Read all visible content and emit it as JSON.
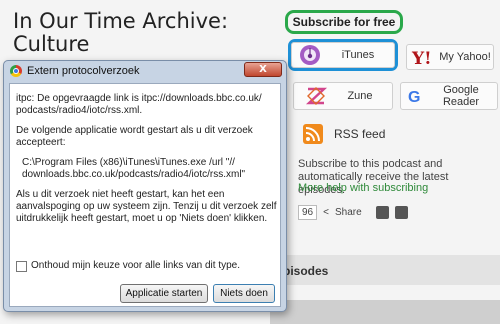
{
  "page": {
    "title": "In Our Time Archive: Culture",
    "subscribe_label": "Subscribe for free",
    "services": [
      {
        "label": "iTunes"
      },
      {
        "label": "My Yahoo!"
      },
      {
        "label": "Zune"
      },
      {
        "label": "Google Reader"
      }
    ],
    "rss_label": "RSS feed",
    "description": "Subscribe to this podcast and automatically receive the latest episodes.",
    "help_link": "More help with subscribing",
    "share_count": "96",
    "share_label": "Share",
    "episodes_label": "pisodes"
  },
  "dialog": {
    "title": "Extern protocolverzoek",
    "close_label": "X",
    "para1": "itpc: De opgevraagde link is itpc://downloads.bbc.co.uk/ podcasts/radio4/iotc/rss.xml.",
    "para2": "De volgende applicatie wordt gestart als u dit verzoek accepteert:",
    "command": "C:\\Program Files (x86)\\iTunes\\iTunes.exe /url \"// downloads.bbc.co.uk/podcasts/radio4/iotc/rss.xml\"",
    "para3": "Als u dit verzoek niet heeft gestart, kan het een aanvalspoging op uw systeem zijn. Tenzij u dit verzoek zelf uitdrukkelijk heeft gestart, moet u op 'Niets doen' klikken.",
    "checkbox_label": "Onthoud mijn keuze voor alle links van dit type.",
    "start_button": "Applicatie starten",
    "nothing_button": "Niets doen"
  },
  "colors": {
    "subscribe_border": "#2aa84a",
    "itunes_border": "#1e90d6",
    "help_link": "#2f8a3a",
    "rss": "#f08a1c"
  }
}
